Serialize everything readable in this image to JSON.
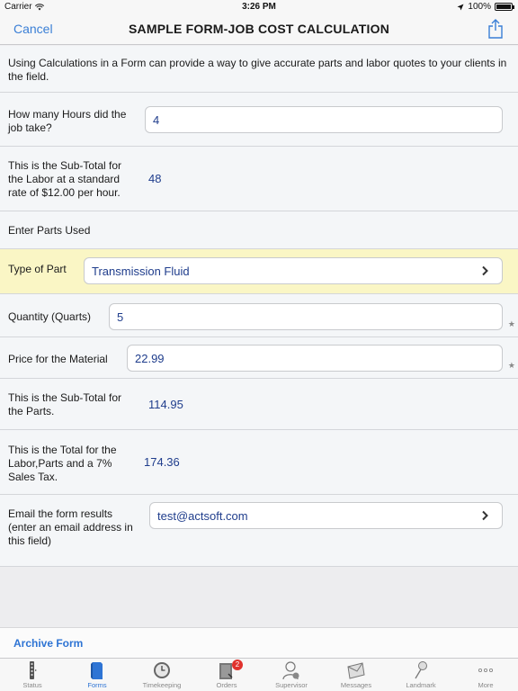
{
  "status_bar": {
    "carrier": "Carrier",
    "time": "3:26 PM",
    "battery": "100%",
    "battery_level": 1.0
  },
  "nav": {
    "cancel_label": "Cancel",
    "title": "SAMPLE FORM-JOB COST CALCULATION",
    "share_icon": "share-icon"
  },
  "form": {
    "intro": "Using Calculations in a Form can provide a way to give accurate parts and labor quotes to your clients in the field.",
    "hours": {
      "label": "How many Hours did the job take?",
      "value": "4"
    },
    "labor_subtotal": {
      "label": "This is the Sub-Total for the Labor at a standard rate of $12.00 per hour.",
      "value": "48"
    },
    "parts_heading": "Enter Parts Used",
    "part_type": {
      "label": "Type of Part",
      "value": "Transmission Fluid"
    },
    "quantity": {
      "label": "Quantity (Quarts)",
      "value": "5"
    },
    "price": {
      "label": "Price for the Material",
      "value": "22.99"
    },
    "parts_subtotal": {
      "label": "This is the Sub-Total for the Parts.",
      "value": "114.95"
    },
    "total": {
      "label": "This is the Total for the Labor,Parts and a 7% Sales Tax.",
      "value": "174.36"
    },
    "email": {
      "label": "Email the form results (enter an email address in this field)",
      "value": "test@actsoft.com"
    }
  },
  "archive_label": "Archive Form",
  "tabs": [
    {
      "label": "Status",
      "icon": "status-icon"
    },
    {
      "label": "Forms",
      "icon": "forms-icon"
    },
    {
      "label": "Timekeeping",
      "icon": "clock-icon"
    },
    {
      "label": "Orders",
      "icon": "orders-icon",
      "badge": "2"
    },
    {
      "label": "Supervisor",
      "icon": "supervisor-icon"
    },
    {
      "label": "Messages",
      "icon": "envelope-icon"
    },
    {
      "label": "Landmark",
      "icon": "pushpin-icon"
    },
    {
      "label": "More",
      "icon": "more-icon"
    }
  ],
  "colors": {
    "accent": "#2e74d4",
    "value_text": "#1f3d8c",
    "highlight_row": "#faf6c5",
    "badge": "#e0322d"
  }
}
